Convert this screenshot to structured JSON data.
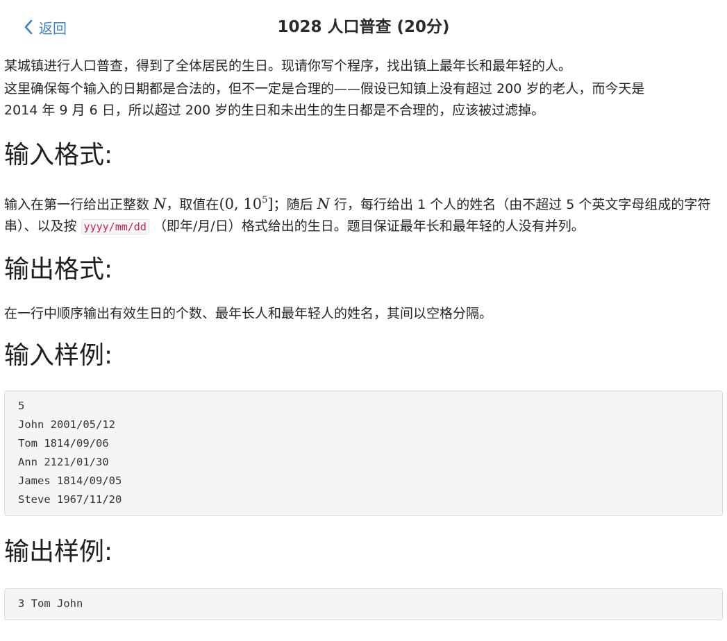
{
  "header": {
    "back_label": "返回",
    "title": "1028 人口普查 (20分)"
  },
  "problem": {
    "paragraph_1": "某城镇进行人口普查，得到了全体居民的生日。现请你写个程序，找出镇上最年长和最年轻的人。",
    "paragraph_2_line_1": "这里确保每个输入的日期都是合法的，但不一定是合理的——假设已知镇上没有超过 200 岁的老人，而今天是",
    "paragraph_2_line_2": "2014 年 9 月 6 日，所以超过 200 岁的生日和未出生的生日都是不合理的，应该被过滤掉。"
  },
  "input_format": {
    "heading": "输入格式:",
    "text_1": "输入在第一行给出正整数 ",
    "var_n": "N",
    "text_2": "，取值在",
    "range_open": "(0, 10",
    "range_exp": "5",
    "range_close": "]",
    "text_3": "；随后 ",
    "text_4": " 行，每行给出 1 个人的姓名（由不超过 5 个英文字母组成的字符串）、以及按 ",
    "date_format": "yyyy/mm/dd",
    "text_5": " （即年/月/日）格式给出的生日。题目保证最年长和最年轻的人没有并列。"
  },
  "output_format": {
    "heading": "输出格式:",
    "text": "在一行中顺序输出有效生日的个数、最年长人和最年轻人的姓名，其间以空格分隔。"
  },
  "sample_input": {
    "heading": "输入样例:",
    "lines": [
      "5",
      "John 2001/05/12",
      "Tom 1814/09/06",
      "Ann 2121/01/30",
      "James 1814/09/05",
      "Steve 1967/11/20"
    ]
  },
  "sample_output": {
    "heading": "输出样例:",
    "lines": [
      "3 Tom John"
    ]
  },
  "colors": {
    "link": "#3b82c4",
    "inline_code": "#c7254e",
    "code_background": "#f5f5f5"
  }
}
